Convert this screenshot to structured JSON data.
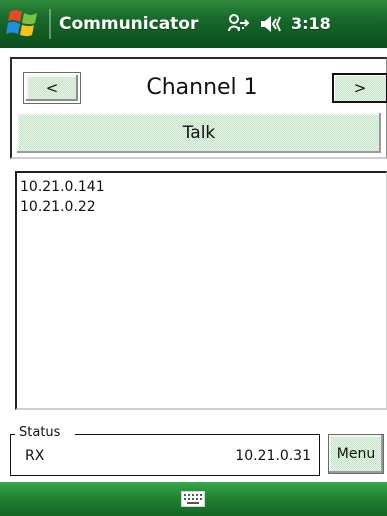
{
  "topbar": {
    "app_title": "Communicator",
    "clock": "3:18",
    "icons": [
      "windows-start-logo",
      "connectivity-icon",
      "volume-icon"
    ]
  },
  "channel_panel": {
    "prev_label": "<",
    "title": "Channel 1",
    "next_label": ">",
    "talk_label": "Talk"
  },
  "peers": {
    "items": [
      "10.21.0.141",
      "10.21.0.22"
    ]
  },
  "status": {
    "legend": "Status",
    "state": "RX",
    "ip": "10.21.0.31"
  },
  "menu": {
    "label": "Menu"
  },
  "bottombar": {
    "icons": [
      "keyboard-icon"
    ]
  },
  "colors": {
    "bar_green": "#17682a",
    "button_green": "#cfe9d1"
  }
}
